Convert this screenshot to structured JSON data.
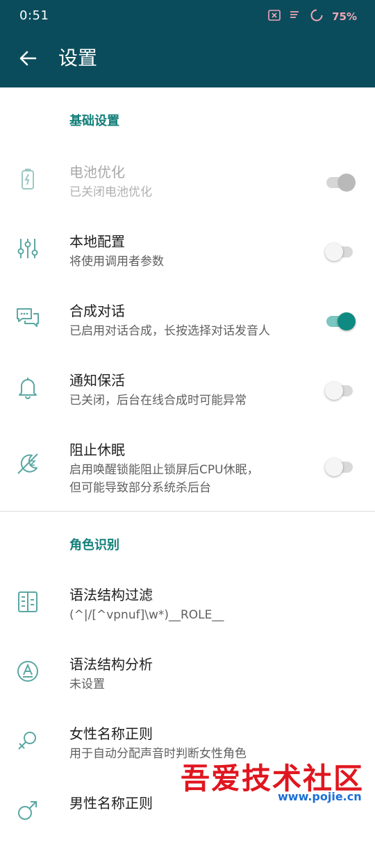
{
  "status": {
    "time": "0:51",
    "battery": "75%"
  },
  "appbar": {
    "title": "设置"
  },
  "sections": {
    "basic": {
      "header": "基础设置",
      "items": [
        {
          "title": "电池优化",
          "summary": "已关闭电池优化",
          "icon": "battery-icon",
          "switch": "disabled-on"
        },
        {
          "title": "本地配置",
          "summary": "将使用调用者参数",
          "icon": "sliders-icon",
          "switch": "off"
        },
        {
          "title": "合成对话",
          "summary": "已启用对话合成，长按选择对话发音人",
          "icon": "chat-icon",
          "switch": "on"
        },
        {
          "title": "通知保活",
          "summary": "已关闭，后台在线合成时可能异常",
          "icon": "bell-icon",
          "switch": "off"
        },
        {
          "title": "阻止休眠",
          "summary_line1": "启用唤醒锁能阻止锁屏后CPU休眠，",
          "summary_line2": "但可能导致部分系统杀后台",
          "icon": "sleep-off-icon",
          "switch": "off"
        }
      ]
    },
    "role": {
      "header": "角色识别",
      "items": [
        {
          "title": "语法结构过滤",
          "summary": "(^|/[^vpnuf]\\w*)__ROLE__",
          "icon": "filter-doc-icon"
        },
        {
          "title": "语法结构分析",
          "summary": "未设置",
          "icon": "text-format-icon"
        },
        {
          "title": "女性名称正则",
          "summary": "用于自动分配声音时判断女性角色",
          "icon": "female-icon"
        },
        {
          "title": "男性名称正则",
          "icon": "male-icon"
        }
      ]
    }
  },
  "watermark": {
    "text": "吾爱技术社区",
    "url": "www.pojie.cn"
  },
  "colors": {
    "toolbar": "#0b4c5c",
    "accent": "#137f7a",
    "icon_tint": "#5aa7a3"
  }
}
